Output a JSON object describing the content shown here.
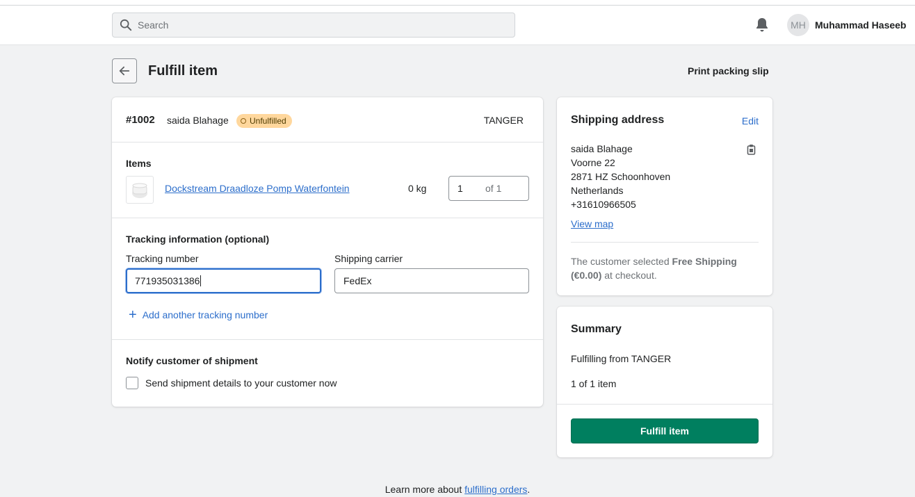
{
  "topbar": {
    "search_placeholder": "Search",
    "avatar_initials": "MH",
    "user_name": "Muhammad Haseeb"
  },
  "page": {
    "title": "Fulfill item",
    "print_packing_slip": "Print packing slip"
  },
  "order": {
    "number": "#1002",
    "customer": "saida Blahage",
    "status": "Unfulfilled",
    "location": "TANGER"
  },
  "items": {
    "heading": "Items",
    "list": [
      {
        "name": "Dockstream Draadloze Pomp Waterfontein",
        "weight": "0 kg",
        "quantity": "1",
        "quantity_of": "of 1"
      }
    ]
  },
  "tracking": {
    "heading": "Tracking information (optional)",
    "number_label": "Tracking number",
    "number_value": "771935031386",
    "carrier_label": "Shipping carrier",
    "carrier_value": "FedEx",
    "add_another": "Add another tracking number"
  },
  "notify": {
    "heading": "Notify customer of shipment",
    "checkbox_label": "Send shipment details to your customer now",
    "checked": false
  },
  "shipping_address": {
    "title": "Shipping address",
    "edit": "Edit",
    "lines": [
      "saida Blahage",
      "Voorne 22",
      "2871 HZ Schoonhoven",
      "Netherlands",
      "+31610966505"
    ],
    "view_map": "View map",
    "note_prefix": "The customer selected ",
    "note_bold": "Free Shipping (€0.00)",
    "note_suffix": " at checkout."
  },
  "summary": {
    "title": "Summary",
    "fulfilling_from": "Fulfilling from TANGER",
    "item_count": "1 of 1 item",
    "button": "Fulfill item"
  },
  "footer": {
    "prefix": "Learn more about ",
    "link": "fulfilling orders",
    "suffix": "."
  },
  "colors": {
    "primary": "#007f5f",
    "link": "#2c6ecb",
    "badge_bg": "#ffd79d",
    "focus": "#2c6ecb"
  }
}
